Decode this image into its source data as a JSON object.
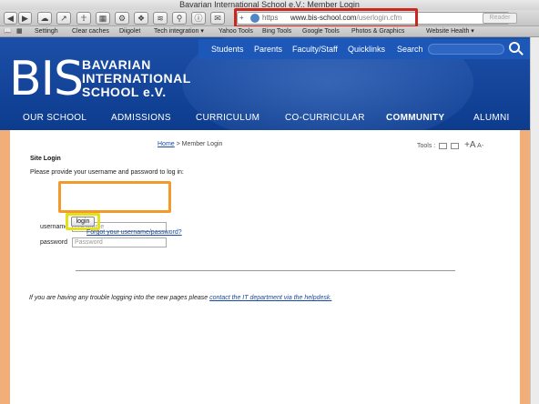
{
  "browser": {
    "window_title": "Bavarian International School e.V.: Member Login",
    "address": {
      "scheme": "https",
      "url_host": "www.bis-school.com",
      "url_path": "/userlogin.cfm",
      "plus": "+",
      "reload": "↻"
    },
    "reader_label": "Reader",
    "bookmarks": [
      "Settingh",
      "Clear caches",
      "Diigolet",
      "Tech integration ▾",
      "Yahoo Tools",
      "Bing Tools",
      "Google Tools",
      "Photos & Graphics",
      "Website Health ▾"
    ]
  },
  "site": {
    "topnav": [
      "Students",
      "Parents",
      "Faculty/Staff",
      "Quicklinks",
      "Search"
    ],
    "logo_mark": "BIS",
    "logo_lines": [
      "BAVARIAN",
      "INTERNATIONAL",
      "SCHOOL e.V."
    ],
    "mainnav": [
      "OUR SCHOOL",
      "ADMISSIONS",
      "CURRICULUM",
      "CO-CURRICULAR",
      "COMMUNITY",
      "ALUMNI"
    ],
    "mainnav_active": "COMMUNITY"
  },
  "content": {
    "breadcrumb_home": "Home",
    "breadcrumb_rest": " > Member Login",
    "tools_label": "Tools :",
    "tools_font_up": "+A",
    "tools_font_down": "A-",
    "section_title": "Site Login",
    "intro": "Please provide your username and password to log in:",
    "username_label": "username",
    "username_placeholder": "Username",
    "password_label": "password",
    "password_placeholder": "Password",
    "login_button": "login",
    "forgot_link": "Forgot your username/password?",
    "trouble_text": "If you are having any trouble logging into the new pages please ",
    "trouble_link": "contact the IT department via the helpdesk."
  },
  "colors": {
    "header_blue": "#0d3c8e",
    "highlight_red": "#c8281e",
    "highlight_orange": "#f39a2c",
    "highlight_yellow": "#e5e01a",
    "page_side": "#f1ae78"
  }
}
